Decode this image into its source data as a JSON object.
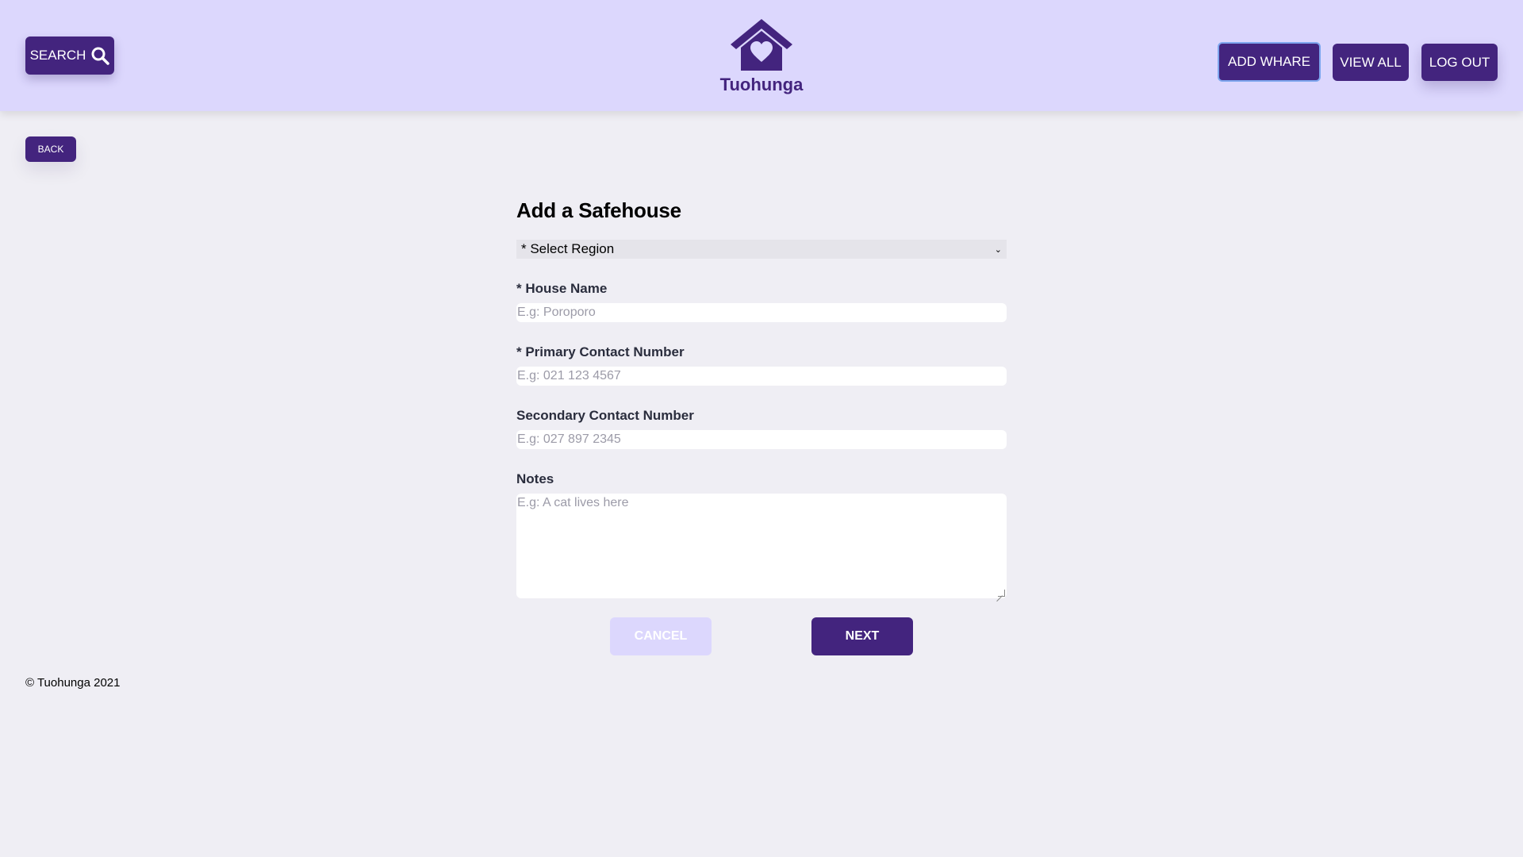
{
  "header": {
    "search_label": "SEARCH",
    "search_icon": "magnifier-icon",
    "brand": "Tuohunga",
    "logo_icon": "house-heart-icon",
    "nav": [
      "ADD WHARE",
      "VIEW ALL",
      "LOG OUT"
    ]
  },
  "back_label": "BACK",
  "form": {
    "title": "Add a Safehouse",
    "region_select": "* Select Region",
    "fields": [
      {
        "label": "* House Name",
        "placeholder": "E.g: Poroporo"
      },
      {
        "label": "* Primary Contact Number",
        "placeholder": "E.g: 021 123 4567"
      },
      {
        "label": "Secondary Contact Number",
        "placeholder": "E.g: 027 897 2345"
      }
    ],
    "notes": {
      "label": "Notes",
      "placeholder": "E.g: A cat lives here"
    },
    "cancel_label": "CANCEL",
    "next_label": "NEXT"
  },
  "footer": "© Tuohunga 2021",
  "colors": {
    "primary": "#43247e",
    "header_bg": "#dcd7fd",
    "page_bg": "#efeef4",
    "focus_ring": "#7ea6ee"
  }
}
